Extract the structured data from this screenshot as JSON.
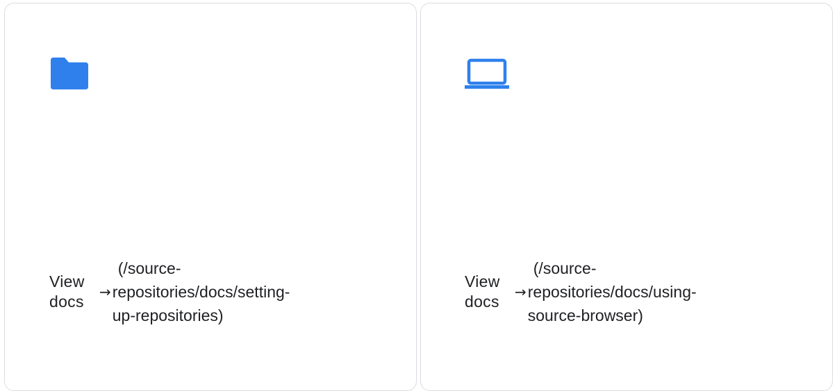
{
  "colors": {
    "border": "#dadce0",
    "icon_blue": "#2f80ed",
    "text": "#202124"
  },
  "cards": [
    {
      "icon": "folder-icon",
      "link_label_line1": "View",
      "link_label_line2": "docs",
      "arrow": "→",
      "path_line1": "(/source-",
      "path_line2": "repositories/docs/setting-",
      "path_line3": "up-repositories)"
    },
    {
      "icon": "laptop-icon",
      "link_label_line1": "View",
      "link_label_line2": "docs",
      "arrow": "→",
      "path_line1": "(/source-",
      "path_line2": "repositories/docs/using-",
      "path_line3": "source-browser)"
    }
  ]
}
